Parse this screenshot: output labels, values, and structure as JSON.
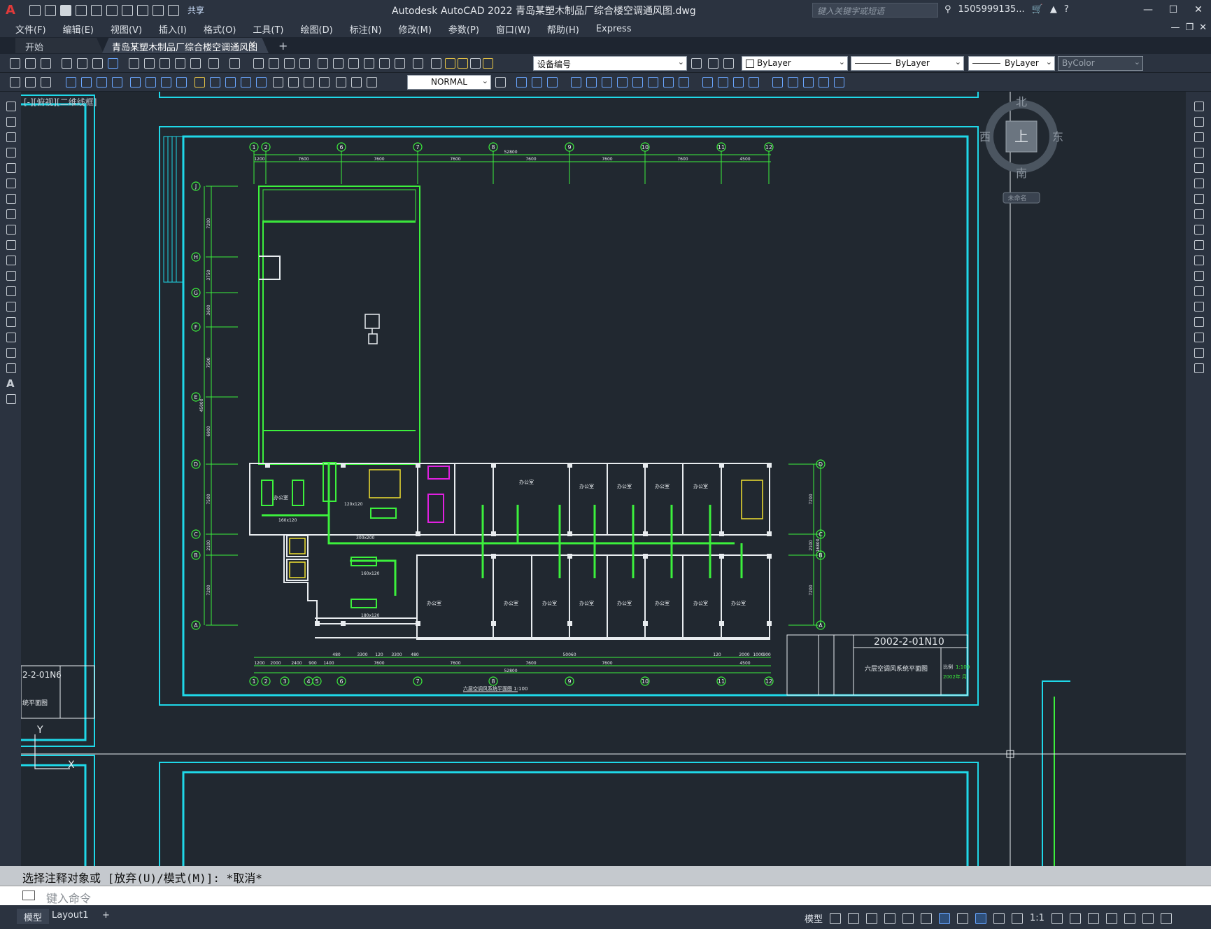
{
  "app": {
    "title": "Autodesk AutoCAD 2022   青岛某塑木制品厂综合楼空调通风图.dwg",
    "share_label": "共享",
    "search_placeholder": "键入关键字或短语",
    "user": "1505999135...",
    "logo": "A"
  },
  "menu": {
    "items": [
      "文件(F)",
      "编辑(E)",
      "视图(V)",
      "插入(I)",
      "格式(O)",
      "工具(T)",
      "绘图(D)",
      "标注(N)",
      "修改(M)",
      "参数(P)",
      "窗口(W)",
      "帮助(H)",
      "Express"
    ]
  },
  "tabs": {
    "start": "开始",
    "active": "青岛某塑木制品厂综合楼空调通风图*",
    "close": "×",
    "add": "+"
  },
  "toolbar": {
    "layer_combo": "设备编号",
    "color_combo": "ByLayer",
    "linetype_combo": "ByLayer",
    "lineweight_combo": "ByLayer",
    "plotstyle_combo": "ByColor",
    "textstyle_combo": "NORMAL"
  },
  "viewport": {
    "label": "[-][俯视][二维线框]"
  },
  "viewcube": {
    "north": "北",
    "south": "南",
    "east": "东",
    "west": "西",
    "face": "上",
    "wcs": "未命名"
  },
  "drawing": {
    "top_dimension_total": "52800",
    "bottom_dimension_total": "52800",
    "top_grid_labels": [
      "1",
      "2",
      "6",
      "7",
      "8",
      "9",
      "10",
      "11",
      "12"
    ],
    "top_spans": [
      "1200",
      "7600",
      "7600",
      "7600",
      "7600",
      "7600",
      "7600",
      "4500"
    ],
    "bottom_grid_labels": [
      "1",
      "2",
      "3",
      "4",
      "5",
      "6",
      "7",
      "8",
      "9",
      "10",
      "11",
      "12"
    ],
    "bottom_spans": [
      "1200",
      "2000",
      "2400",
      "900",
      "1400",
      "7600",
      "7600",
      "7600",
      "7600",
      "4500"
    ],
    "bottom_extra_spans": [
      "480",
      "3300",
      "120",
      "3300",
      "480",
      "50060",
      "120",
      "2000",
      "1000",
      "900"
    ],
    "row_labels_left": [
      "J",
      "H",
      "G",
      "F",
      "E",
      "D",
      "C",
      "B",
      "A"
    ],
    "row_labels_right": [
      "D",
      "C",
      "B",
      "A"
    ],
    "left_row_spans": [
      "7200",
      "3750",
      "3600",
      "7500",
      "6900",
      "7500",
      "2100",
      "7200"
    ],
    "left_total": "45000",
    "right_row_spans": [
      "7200",
      "2100",
      "16800",
      "7200"
    ],
    "room_label": "办公室",
    "duct_sizes": [
      "120x120",
      "160x120",
      "160x120",
      "300x200",
      "180x120"
    ],
    "plan_caption": "六层空调风系统平面图 1:100",
    "title_block": {
      "drawing_number": "2002-2-01N10",
      "drawing_name": "六层空调风系统平面图",
      "scale_label": "比例",
      "scale": "1:100",
      "date": "2002年 月",
      "left_number": "2-2-01N6",
      "left_name": "统平面图"
    }
  },
  "ucs": {
    "x": "X",
    "y": "Y"
  },
  "command": {
    "history": "选择注释对象或 [放弃(U)/模式(M)]: *取消*",
    "placeholder": "键入命令"
  },
  "status": {
    "model_tab": "模型",
    "layout_tab": "Layout1",
    "add_tab": "+",
    "mode": "模型",
    "scale": "1:1"
  },
  "colors": {
    "canvas": "#212830",
    "cyan_frame": "#1fd8e8",
    "green_lines": "#3cf03c",
    "magenta": "#e020e0",
    "yellow": "#f0e030",
    "white": "#e8ecef"
  }
}
